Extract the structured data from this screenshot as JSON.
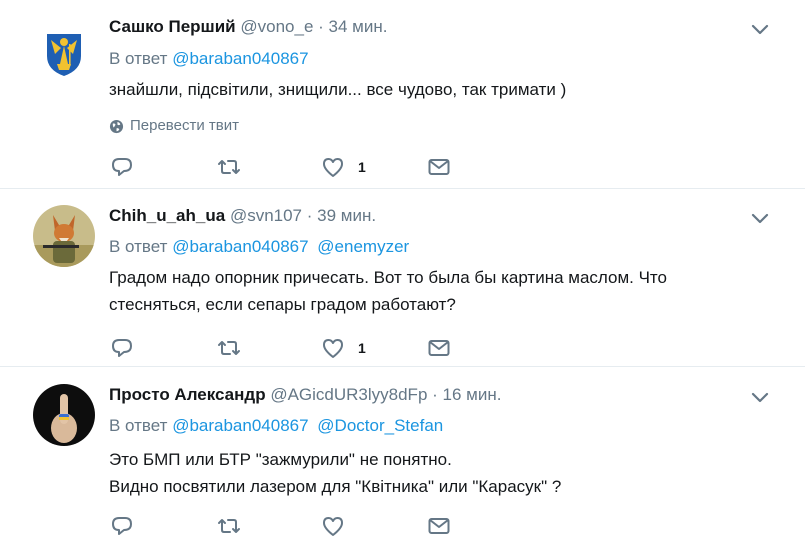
{
  "tweets": [
    {
      "name": "Сашко Перший",
      "handle": "@vono_e",
      "dot": "·",
      "time": "34 мин.",
      "reply_prefix": "В ответ",
      "mentions": [
        "@baraban040867"
      ],
      "text_lines": [
        "знайшли, підсвітили, знищили... все чудово, так тримати )"
      ],
      "translate": "Перевести твит",
      "likes": "1",
      "avatar_icon": "kyiv-coat-of-arms"
    },
    {
      "name": "Chih_u_ah_ua",
      "handle": "@svn107",
      "dot": "·",
      "time": "39 мин.",
      "reply_prefix": "В ответ",
      "mentions": [
        "@baraban040867",
        "@enemyzer"
      ],
      "text_lines": [
        "Градом надо опорник причесать. Вот то была бы картина маслом. Что",
        "стесняться, если сепары градом работают?"
      ],
      "likes": "1",
      "avatar_icon": "fox-soldier-portrait"
    },
    {
      "name": "Просто Александр",
      "handle": "@AGicdUR3lyy8dFp",
      "dot": "·",
      "time": "16 мин.",
      "reply_prefix": "В ответ",
      "mentions": [
        "@baraban040867",
        "@Doctor_Stefan"
      ],
      "text_lines": [
        "Это БМП или БТР \"зажмурили\" не понятно.",
        "Видно посвятили лазером для \"Квітника\" или \"Карасук\" ?"
      ],
      "likes": "",
      "avatar_icon": "hand-gesture-photo"
    }
  ],
  "colors": {
    "text": "#14171a",
    "secondary": "#657786",
    "link": "#1b95e0",
    "divider": "#e6ecf0"
  },
  "icons": {
    "reply": "reply-icon",
    "retweet": "retweet-icon",
    "like": "heart-icon",
    "dm": "envelope-icon",
    "menu": "chevron-down-icon",
    "translate": "globe-icon"
  }
}
